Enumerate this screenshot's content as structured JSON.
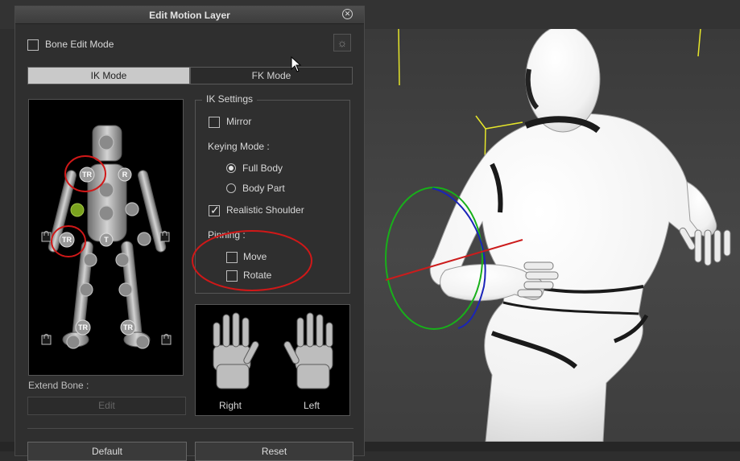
{
  "dialog": {
    "title": "Edit Motion Layer",
    "close_icon": "close-icon"
  },
  "bone_edit": {
    "label": "Bone Edit Mode",
    "checked": false
  },
  "tabs": [
    {
      "label": "IK Mode",
      "active": true
    },
    {
      "label": "FK Mode",
      "active": false
    }
  ],
  "body_map": {
    "markers": [
      {
        "id": "tr-shoulder",
        "label": "TR"
      },
      {
        "id": "r-shoulder",
        "label": "R"
      },
      {
        "id": "tr-hand",
        "label": "TR"
      },
      {
        "id": "t-hip",
        "label": "T"
      },
      {
        "id": "tr-foot-right",
        "label": "TR"
      },
      {
        "id": "tr-foot-left",
        "label": "TR"
      }
    ],
    "lock_icon": "lock-icon"
  },
  "ik_settings": {
    "title": "IK Settings",
    "mirror": {
      "label": "Mirror",
      "checked": false
    },
    "keying_mode_label": "Keying Mode :",
    "keying_options": [
      {
        "label": "Full Body",
        "selected": true
      },
      {
        "label": "Body Part",
        "selected": false
      }
    ],
    "realistic_shoulder": {
      "label": "Realistic Shoulder",
      "checked": true
    },
    "pinning_label": "Pinning :",
    "pin_move": {
      "label": "Move",
      "checked": false
    },
    "pin_rotate": {
      "label": "Rotate",
      "checked": false
    }
  },
  "hands": {
    "right_label": "Right",
    "left_label": "Left"
  },
  "extend_bone": {
    "label": "Extend Bone :",
    "edit_label": "Edit"
  },
  "buttons": {
    "default_label": "Default",
    "reset_label": "Reset"
  },
  "colors": {
    "annotation": "#d01818",
    "active_bone": "#7aa21e",
    "gizmo_x": "#cc1c1c",
    "gizmo_y": "#18b01a",
    "gizmo_z": "#1a24b8",
    "bone_line": "#e6e62a"
  }
}
